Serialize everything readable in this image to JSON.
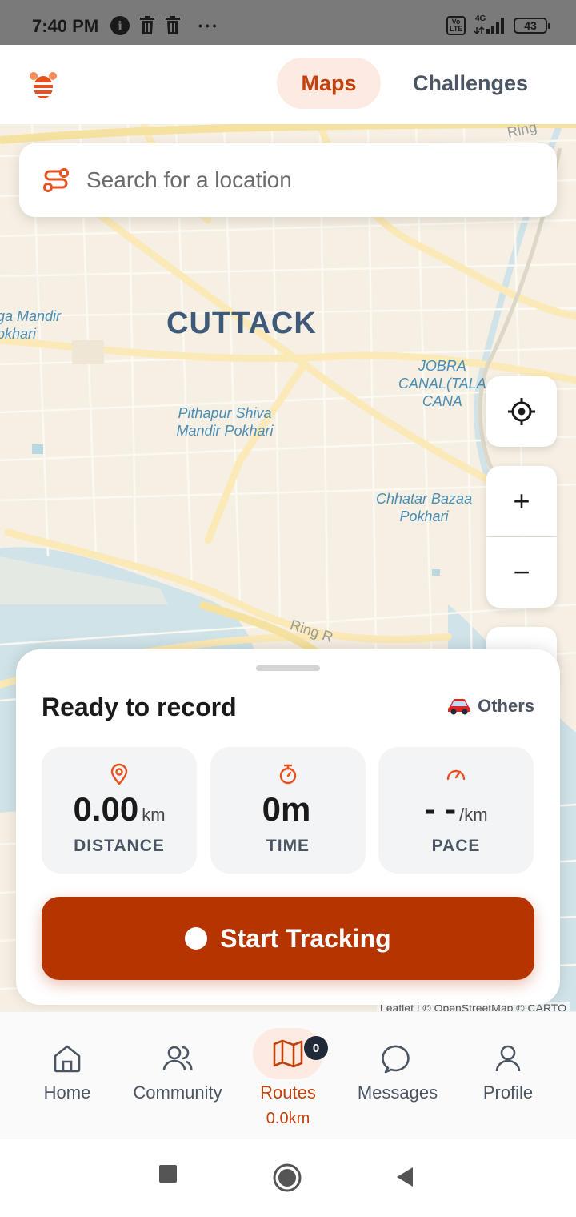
{
  "status_bar": {
    "time": "7:40 PM",
    "more": "• • •",
    "network": "4G",
    "volte": "Vo LTE",
    "battery": "43"
  },
  "header": {
    "tabs": [
      {
        "label": "Maps",
        "active": true
      },
      {
        "label": "Challenges",
        "active": false
      }
    ]
  },
  "search": {
    "placeholder": "Search for a location"
  },
  "map": {
    "city": "CUTTACK",
    "labels": {
      "mandir_pokhari": "ga Mandir\nokhari",
      "pithapur": "Pithapur Shiva\nMandir Pokhari",
      "jobra": "JOBRA\nCANAL(TALA\nCANA",
      "chhatar": "Chhatar Bazaa\nPokhari",
      "ring_top": "Ring",
      "ring_bottom": "Ring R"
    },
    "attribution": "Leaflet | © OpenStreetMap © CARTO"
  },
  "controls": {
    "zoom_in": "+",
    "zoom_out": "−"
  },
  "sheet": {
    "title": "Ready to record",
    "mode": "Others",
    "stats": [
      {
        "icon": "map-pin-icon",
        "value": "0.00",
        "unit": "km",
        "label": "DISTANCE"
      },
      {
        "icon": "stopwatch-icon",
        "value": "0m",
        "unit": "",
        "label": "TIME"
      },
      {
        "icon": "speedometer-icon",
        "value": "- -",
        "unit": "/km",
        "label": "PACE"
      }
    ],
    "start_button": "Start Tracking"
  },
  "bottom_nav": {
    "items": [
      {
        "label": "Home",
        "icon": "home-icon"
      },
      {
        "label": "Community",
        "icon": "users-icon"
      },
      {
        "label": "Routes",
        "icon": "map-icon",
        "badge": "0",
        "sub": "0.0km",
        "active": true
      },
      {
        "label": "Messages",
        "icon": "message-icon"
      },
      {
        "label": "Profile",
        "icon": "user-icon"
      }
    ]
  },
  "colors": {
    "accent": "#c2410c",
    "primary_button": "#b53400",
    "map_background": "#f6efe3",
    "water": "#cfe3e8"
  }
}
